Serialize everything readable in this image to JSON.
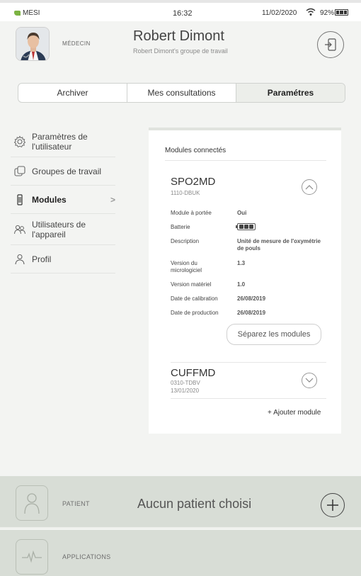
{
  "status_bar": {
    "carrier": "MESI",
    "time": "16:32",
    "date": "11/02/2020",
    "battery": "92%"
  },
  "header": {
    "role": "MÉDECIN",
    "user_name": "Robert Dimont",
    "group_name": "Robert Dimont's groupe de travail"
  },
  "tabs": [
    {
      "label": "Archiver",
      "active": false
    },
    {
      "label": "Mes consultations",
      "active": false
    },
    {
      "label": "Paramétres",
      "active": true
    }
  ],
  "sidebar": {
    "items": [
      {
        "label_1": "Paramètres de",
        "label_2": "l'utilisateur",
        "icon": "gear-icon"
      },
      {
        "label": "Groupes de travail",
        "icon": "groups-icon"
      },
      {
        "label": "Modules",
        "icon": "module-icon",
        "active": true
      },
      {
        "label_1": "Utilisateurs de",
        "label_2": "l'appareil",
        "icon": "device-users-icon"
      },
      {
        "label": "Profil",
        "icon": "profile-icon"
      }
    ]
  },
  "card": {
    "title": "Modules connectés",
    "module1": {
      "name": "SPO2MD",
      "serial": "1110-DBUK",
      "fields": {
        "range_label": "Module à portée",
        "range_value": "Oui",
        "battery_label": "Batterie",
        "description_label": "Description",
        "description_value_1": "Unité de mesure de l'oxymétrie",
        "description_value_2": "de pouls",
        "fw_label_1": "Version du",
        "fw_label_2": "micrologiciel",
        "fw_value": "1.3",
        "hw_label": "Version matériel",
        "hw_value": "1.0",
        "calibration_label": "Date de calibration",
        "calibration_value": "26/08/2019",
        "production_label": "Date de production",
        "production_value": "26/08/2019"
      },
      "separate_button": "Séparez les modules"
    },
    "module2": {
      "name": "CUFFMD",
      "serial": "0310-TDBV",
      "date": "13/01/2020"
    },
    "add_module": "+ Ajouter module"
  },
  "patient_panel": {
    "label": "PATIENT",
    "status": "Aucun patient choisi"
  },
  "applications_panel": {
    "label": "APPLICATIONS"
  },
  "colors": {
    "background": "#f3f4f2",
    "bottom_panel": "#d8ddd6",
    "carrier_logo": "#7cb342"
  }
}
